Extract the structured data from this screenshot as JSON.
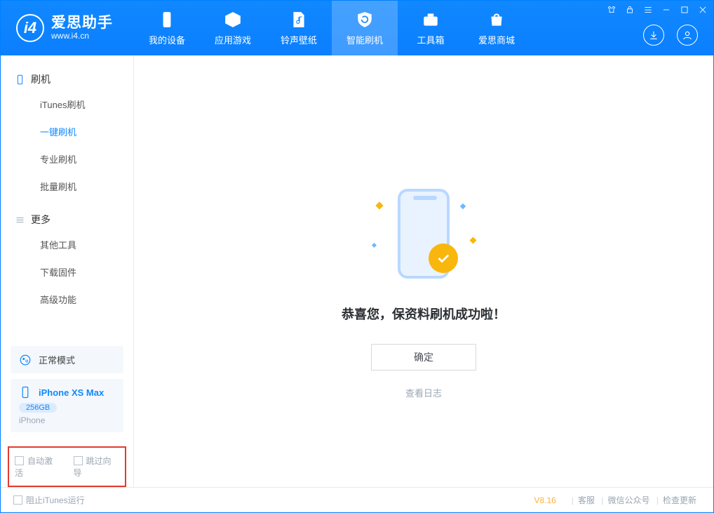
{
  "brand": {
    "title": "爱思助手",
    "subtitle": "www.i4.cn"
  },
  "tabs": [
    {
      "label": "我的设备"
    },
    {
      "label": "应用游戏"
    },
    {
      "label": "铃声壁纸"
    },
    {
      "label": "智能刷机"
    },
    {
      "label": "工具箱"
    },
    {
      "label": "爱思商城"
    }
  ],
  "sidebar": {
    "group1": {
      "title": "刷机",
      "items": [
        "iTunes刷机",
        "一键刷机",
        "专业刷机",
        "批量刷机"
      ]
    },
    "group2": {
      "title": "更多",
      "items": [
        "其他工具",
        "下载固件",
        "高级功能"
      ]
    },
    "mode": "正常模式",
    "device": {
      "name": "iPhone XS Max",
      "capacity": "256GB",
      "type": "iPhone"
    },
    "options": {
      "auto_activate": "自动激活",
      "skip_wizard": "跳过向导"
    }
  },
  "main": {
    "success": "恭喜您，保资料刷机成功啦！",
    "ok": "确定",
    "view_log": "查看日志"
  },
  "footer": {
    "block_itunes": "阻止iTunes运行",
    "version": "V8.16",
    "links": [
      "客服",
      "微信公众号",
      "检查更新"
    ]
  }
}
